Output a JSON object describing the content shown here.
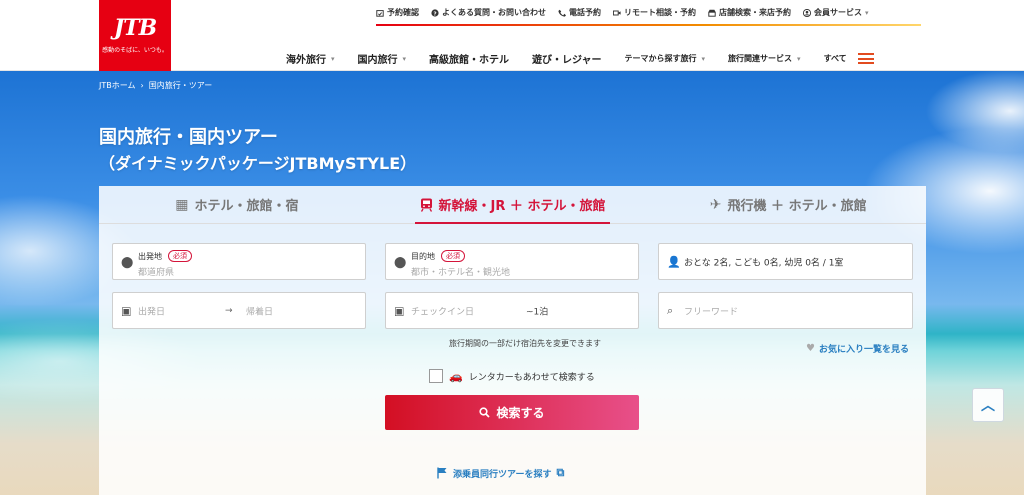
{
  "header": {
    "logo_text": "JTB",
    "logo_tagline": "感動のそばに、いつも。",
    "util_nav": [
      {
        "label": "予約確認",
        "icon": "calendar-check-icon"
      },
      {
        "label": "よくある質問・お問い合わせ",
        "icon": "question-icon"
      },
      {
        "label": "電話予約",
        "icon": "phone-icon"
      },
      {
        "label": "リモート相談・予約",
        "icon": "video-icon"
      },
      {
        "label": "店舗検索・来店予約",
        "icon": "store-icon"
      },
      {
        "label": "会員サービス",
        "icon": "user-icon"
      }
    ],
    "main_nav": [
      {
        "label": "海外旅行"
      },
      {
        "label": "国内旅行"
      },
      {
        "label": "高級旅館・ホテル"
      },
      {
        "label": "遊び・レジャー"
      },
      {
        "label": "テーマから探す旅行"
      },
      {
        "label": "旅行関連サービス"
      },
      {
        "label": "すべて"
      }
    ],
    "accent_color": "#e60012"
  },
  "breadcrumb": [
    "JTBホーム",
    "国内旅行・ツアー"
  ],
  "hero": {
    "title": "国内旅行・国内ツアー",
    "subtitle": "（ダイナミックパッケージJTBMySTYLE）"
  },
  "search": {
    "tabs": [
      {
        "label": "ホテル・旅館・宿",
        "icon": "building-icon",
        "active": false
      },
      {
        "label": "新幹線・JR ＋ ホテル・旅館",
        "icon": "train-icon",
        "active": true
      },
      {
        "label": "飛行機 ＋ ホテル・旅館",
        "icon": "airplane-icon",
        "active": false
      }
    ],
    "origin": {
      "label": "出発地",
      "required": "必須",
      "placeholder": "都道府県"
    },
    "destination": {
      "label": "目的地",
      "required": "必須",
      "placeholder": "都市・ホテル名・観光地"
    },
    "guests": {
      "value": "おとな 2名, こども 0名, 幼児 0名 / 1室"
    },
    "depart_date": {
      "placeholder": "出発日"
    },
    "arrow": "→",
    "return_date": {
      "placeholder": "帰着日"
    },
    "checkin": {
      "placeholder": "チェックイン日",
      "nights": "~1泊"
    },
    "keyword": {
      "placeholder": "フリーワード"
    },
    "note": "旅行期間の一部だけ宿泊先を変更できます",
    "favorites_link": "お気に入り一覧を見る",
    "rental_car_label": "レンタカーもあわせて検索する",
    "search_button": "検索する",
    "escorted_tour_link": "添乗員同行ツアーを探す"
  }
}
